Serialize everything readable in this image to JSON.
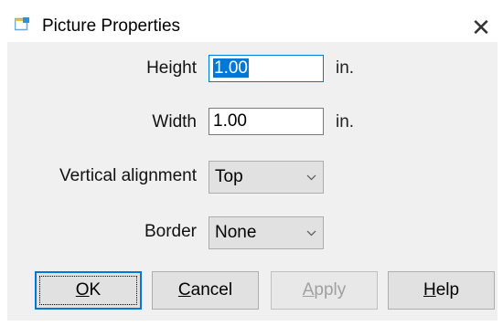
{
  "window": {
    "title": "Picture Properties",
    "close_glyph": "✕",
    "icon": "picture-app-icon"
  },
  "form": {
    "height": {
      "label": "Height",
      "value": "1.00",
      "unit": "in."
    },
    "width": {
      "label": "Width",
      "value": "1.00",
      "unit": "in."
    },
    "vertical_alignment": {
      "label": "Vertical alignment",
      "selected": "Top"
    },
    "border": {
      "label": "Border",
      "selected": "None"
    }
  },
  "buttons": {
    "ok": {
      "mnemonic": "O",
      "rest": "K"
    },
    "cancel": {
      "mnemonic": "C",
      "rest": "ancel"
    },
    "apply": {
      "mnemonic": "A",
      "rest": "pply",
      "enabled": false
    },
    "help": {
      "mnemonic": "H",
      "rest": "elp"
    }
  },
  "colors": {
    "accent": "#0078d7",
    "dialog_bg": "#f0f0f0",
    "button_bg": "#e1e1e1"
  }
}
